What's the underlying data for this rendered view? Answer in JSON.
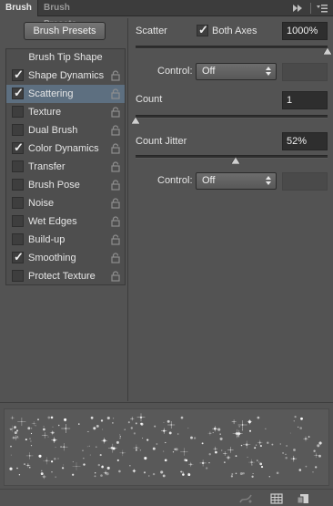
{
  "tabs": {
    "brush": "Brush",
    "brush_presets": "Brush Presets"
  },
  "presets_button": "Brush Presets",
  "categories": {
    "header": "Brush Tip Shape",
    "items": [
      {
        "label": "Shape Dynamics",
        "checked": true,
        "selected": false
      },
      {
        "label": "Scattering",
        "checked": true,
        "selected": true
      },
      {
        "label": "Texture",
        "checked": false,
        "selected": false
      },
      {
        "label": "Dual Brush",
        "checked": false,
        "selected": false
      },
      {
        "label": "Color Dynamics",
        "checked": true,
        "selected": false
      },
      {
        "label": "Transfer",
        "checked": false,
        "selected": false
      },
      {
        "label": "Brush Pose",
        "checked": false,
        "selected": false
      },
      {
        "label": "Noise",
        "checked": false,
        "selected": false
      },
      {
        "label": "Wet Edges",
        "checked": false,
        "selected": false
      },
      {
        "label": "Build-up",
        "checked": false,
        "selected": false
      },
      {
        "label": "Smoothing",
        "checked": true,
        "selected": false
      },
      {
        "label": "Protect Texture",
        "checked": false,
        "selected": false
      }
    ]
  },
  "scatter": {
    "label": "Scatter",
    "both_axes_label": "Both Axes",
    "both_axes_checked": true,
    "value": "1000%",
    "slider_fraction": 1.0,
    "control_label": "Control:",
    "control_value": "Off"
  },
  "count": {
    "label": "Count",
    "value": "1",
    "slider_fraction": 0.0
  },
  "count_jitter": {
    "label": "Count Jitter",
    "value": "52%",
    "slider_fraction": 0.52,
    "control_label": "Control:",
    "control_value": "Off"
  },
  "colors": {
    "panel_bg": "#535353",
    "selected_row": "#5d6f80",
    "field_bg": "#2e2e2e",
    "text": "#e6e6e6"
  },
  "icons": [
    "fast-forward-icon",
    "panel-menu-icon",
    "lock-icon",
    "brush-stroke-icon",
    "grid-icon",
    "new-preset-icon"
  ]
}
